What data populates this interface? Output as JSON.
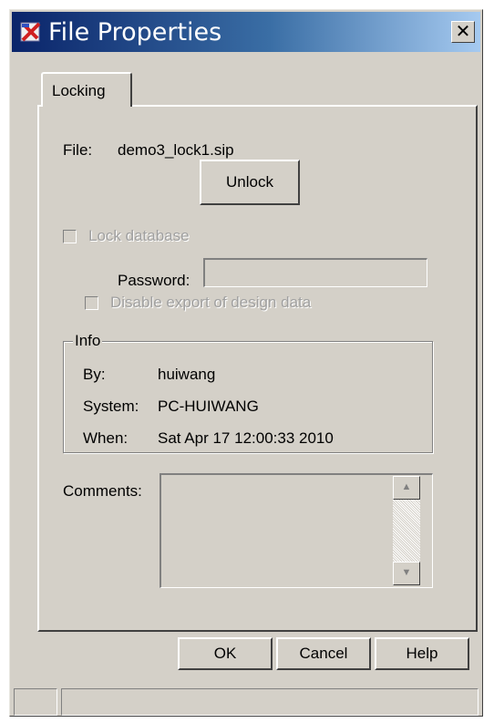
{
  "window": {
    "title": "File Properties",
    "close_label": "✕"
  },
  "tabs": [
    {
      "label": "Locking",
      "selected": true
    }
  ],
  "locking": {
    "file_label": "File:",
    "file_value": "demo3_lock1.sip",
    "unlock_label": "Unlock",
    "lock_database_label": "Lock database",
    "lock_database_checked": false,
    "password_label": "Password:",
    "password_value": "",
    "disable_export_label": "Disable export of design data",
    "disable_export_checked": false
  },
  "info": {
    "legend": "Info",
    "by_label": "By:",
    "by_value": "huiwang",
    "system_label": "System:",
    "system_value": "PC-HUIWANG",
    "when_label": "When:",
    "when_value": "Sat Apr 17 12:00:33 2010"
  },
  "comments": {
    "label": "Comments:",
    "value": ""
  },
  "buttons": {
    "ok_label": "OK",
    "cancel_label": "Cancel",
    "help_label": "Help"
  },
  "icons": {
    "title_icon": "app-icon",
    "scroll_up": "scroll-up-icon",
    "scroll_down": "scroll-down-icon"
  },
  "colors": {
    "titlebar_start": "#0a246a",
    "titlebar_end": "#a6caf0",
    "dialog_face": "#d4d0c8",
    "disabled_text": "#a0a0a0"
  }
}
